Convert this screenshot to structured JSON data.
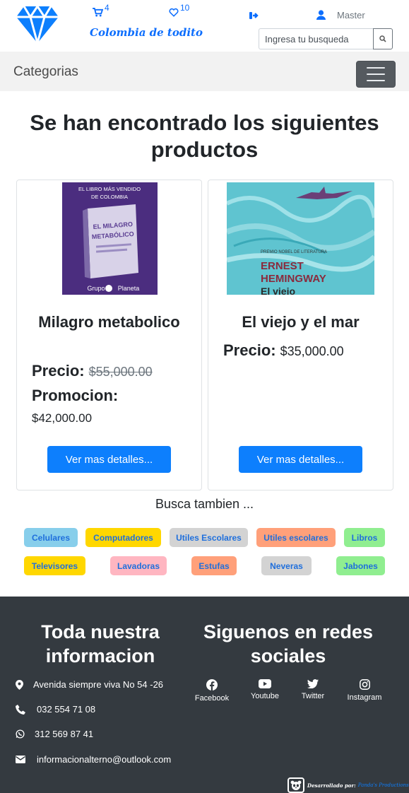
{
  "header": {
    "tagline": "Colombia de todito",
    "cart_count": "4",
    "favorites_count": "10",
    "user_name": "Master",
    "search_placeholder": "Ingresa tu busqueda"
  },
  "navbar": {
    "categories_label": "Categorias"
  },
  "main": {
    "title": "Se han encontrado los siguientes productos",
    "price_label": "Precio:",
    "promo_label": "Promocion:",
    "details_button": "Ver mas detalles...",
    "products": [
      {
        "name": "Milagro metabolico",
        "price": "$55,000.00",
        "promo_price": "$42,000.00",
        "cover": {
          "top_text": "EL LIBRO MÁS VENDIDO DE COLOMBIA",
          "book_title": "EL MILAGRO METABÓLICO",
          "publisher": "Grupo Planeta"
        }
      },
      {
        "name": "El viejo y el mar",
        "price": "$35,000.00",
        "cover": {
          "award": "PREMIO NOBEL DE LITERATURA",
          "author": "ERNEST HEMINGWAY",
          "book_title": "El viejo"
        }
      }
    ]
  },
  "related": {
    "title": "Busca tambien ...",
    "tags": [
      {
        "label": "Celulares",
        "color": "#87ceeb"
      },
      {
        "label": "Computadores",
        "color": "#ffd700"
      },
      {
        "label": "Utiles Escolares",
        "color": "#d3d3d3"
      },
      {
        "label": "Utiles escolares",
        "color": "#ffa07a"
      },
      {
        "label": "Libros",
        "color": "#90ee90"
      },
      {
        "label": "Televisores",
        "color": "#ffd700"
      },
      {
        "label": "Lavadoras",
        "color": "#ffb6c1"
      },
      {
        "label": "Estufas",
        "color": "#ffa07a"
      },
      {
        "label": "Neveras",
        "color": "#d3d3d3"
      },
      {
        "label": "Jabones",
        "color": "#90ee90"
      }
    ]
  },
  "footer": {
    "info_title": "Toda nuestra informacion",
    "address": "Avenida siempre viva No 54 -26",
    "phone": "032 554 71 08",
    "whatsapp": "312 569 87 41",
    "email": "informacionalterno@outlook.com",
    "social_title": "Siguenos en redes sociales",
    "socials": [
      "Facebook",
      "Youtube",
      "Twitter",
      "Instagram"
    ],
    "credit_prefix": "Desarrollado por:",
    "credit_name": "Panda's Productions"
  },
  "colors": {
    "primary": "#0d7ffd",
    "footer_bg": "#343a40",
    "navbar_bg": "#f2f2f2"
  }
}
